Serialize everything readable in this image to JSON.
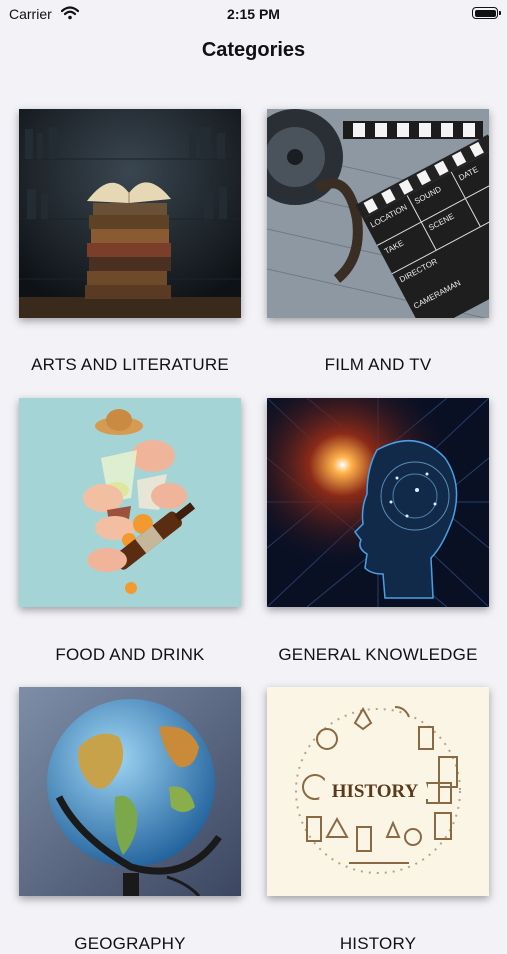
{
  "status_bar": {
    "carrier": "Carrier",
    "time": "2:15 PM"
  },
  "header": {
    "title": "Categories"
  },
  "categories": [
    {
      "label": "ARTS AND LITERATURE",
      "image": "stacked-old-books"
    },
    {
      "label": "FILM AND TV",
      "image": "film-reel-and-clapperboard"
    },
    {
      "label": "FOOD AND DRINK",
      "image": "hands-holding-drinks"
    },
    {
      "label": "GENERAL KNOWLEDGE",
      "image": "glowing-head-silhouette"
    },
    {
      "label": "GEOGRAPHY",
      "image": "world-globe"
    },
    {
      "label": "HISTORY",
      "image": "history-icons-circle"
    }
  ],
  "history_badge_text": "HISTORY",
  "clapper_text": [
    "LOCATION",
    "SOUND",
    "DATE",
    "TAKE",
    "SCENE",
    "DIRECTOR",
    "CAMERAMAN"
  ]
}
